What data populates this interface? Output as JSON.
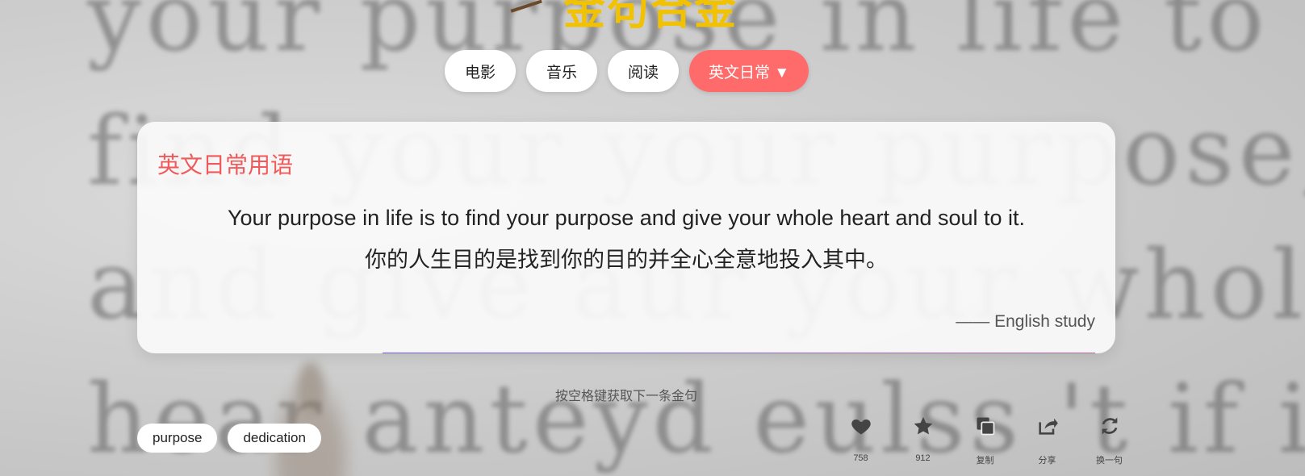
{
  "logo": {
    "text": "金句合金"
  },
  "nav": {
    "items": [
      {
        "label": "电影"
      },
      {
        "label": "音乐"
      },
      {
        "label": "阅读"
      },
      {
        "label": "英文日常 ▼"
      }
    ]
  },
  "card": {
    "title": "英文日常用语",
    "quote_en": "Your purpose in life is to find your purpose and give your whole heart and soul to it.",
    "quote_zh": "你的人生目的是找到你的目的并全心全意地投入其中。",
    "author": "—— English study"
  },
  "hint": "按空格键获取下一条金句",
  "tags": [
    {
      "label": "purpose"
    },
    {
      "label": "dedication"
    }
  ],
  "actions": [
    {
      "icon": "heart-icon",
      "label": "758"
    },
    {
      "icon": "star-icon",
      "label": "912"
    },
    {
      "icon": "copy-icon",
      "label": "复制"
    },
    {
      "icon": "share-icon",
      "label": "分享"
    },
    {
      "icon": "refresh-icon",
      "label": "换一句"
    }
  ],
  "background_text": "your purpose in life to\nfind your your purpose,\nand give aur your whole\nhear anteyd eulss 't if iit!",
  "colors": {
    "accent": "#ff6b6b",
    "title": "#f05a5a",
    "logo": "#f2c200"
  }
}
